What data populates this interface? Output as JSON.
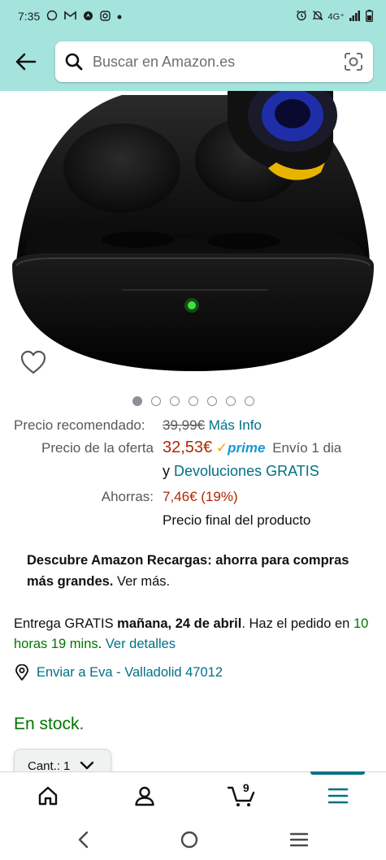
{
  "status_bar": {
    "time": "7:35",
    "network": "4G⁺",
    "left_icons": [
      "whatsapp-icon",
      "gmail-icon",
      "location-icon",
      "instagram-icon",
      "dot-icon"
    ],
    "right_icons": [
      "alarm-icon",
      "mute-icon",
      "network-icon",
      "signal-icon",
      "battery-icon"
    ]
  },
  "header": {
    "search_placeholder": "Buscar en Amazon.es",
    "icons": [
      "back-arrow-icon",
      "search-icon",
      "camera-lens-icon"
    ]
  },
  "gallery": {
    "image_count": 7,
    "active_index": 0,
    "wishlist_icon": "heart-outline-icon"
  },
  "pricing": {
    "list_label": "Precio recomendado:",
    "list_price": "39,99€",
    "more_info": "Más Info",
    "deal_label": "Precio de la oferta",
    "deal_price": "32,53€",
    "prime_label": "prime",
    "prime_shipping": "Envío 1 dia",
    "and": "y",
    "free_returns": "Devoluciones GRATIS",
    "savings_label": "Ahorras:",
    "savings_value": "7,46€ (19%)",
    "final_price_note": "Precio final del producto"
  },
  "promo": {
    "bold_text": "Descubre Amazon Recargas: ahorra para compras más grandes.",
    "link_text": "Ver más."
  },
  "delivery": {
    "free_text": "Entrega GRATIS",
    "date": "mañana, 24 de abril",
    "order_text": ". Haz el pedido en",
    "countdown": "10 horas 19 mins",
    "dot": ".",
    "details_link": "Ver detalles"
  },
  "ship_to": {
    "text": "Enviar a Eva - Valladolid 47012",
    "icon": "location-pin-icon"
  },
  "stock": {
    "text": "En stock."
  },
  "quantity": {
    "label": "Cant.:",
    "value": "1"
  },
  "bottom_nav": {
    "cart_count": "9",
    "active": "menu",
    "items": [
      "home-icon",
      "account-icon",
      "cart-icon",
      "menu-icon"
    ]
  },
  "colors": {
    "header_bg": "#a4e4dd",
    "link": "#007185",
    "price_red": "#b12704",
    "stock_green": "#007600",
    "prime_blue": "#1399d6"
  }
}
